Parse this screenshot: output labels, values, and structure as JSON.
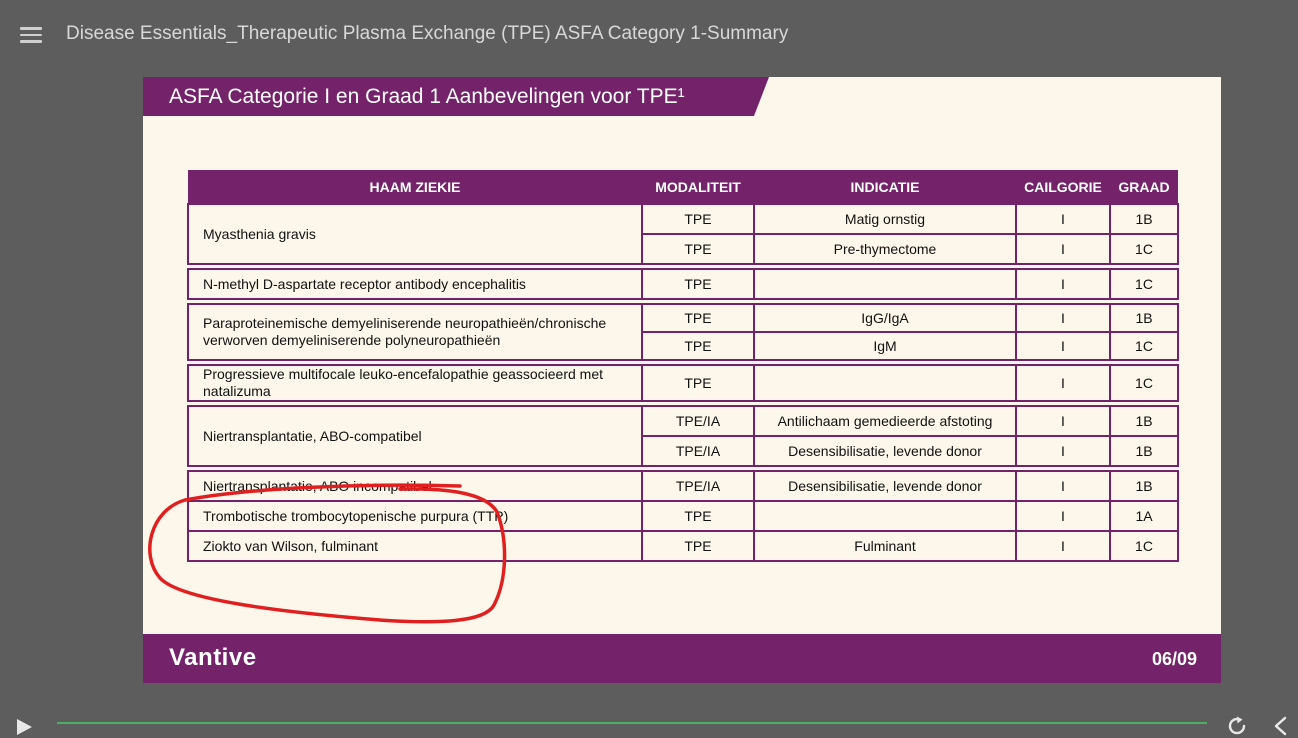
{
  "app": {
    "course_title": "Disease Essentials_Therapeutic Plasma Exchange (TPE) ASFA Category 1-Summary",
    "icons": {
      "menu": "hamburger-menu-icon",
      "play": "play-icon",
      "replay": "replay-icon",
      "back": "chevron-left-icon"
    },
    "colors": {
      "background": "#5d5d5d",
      "progress": "#4caf62"
    }
  },
  "slide": {
    "title": "ASFA Categorie I en Graad 1 Aanbevelingen voor TPE¹",
    "colors": {
      "brand": "#74226a",
      "paper": "#fcf7ea",
      "annotation": "#e02020"
    },
    "table": {
      "headers": [
        "HAAM ZIEKIE",
        "MODALITEIT",
        "INDICATIE",
        "CAILGORIE",
        "GRAAD"
      ],
      "groups": [
        {
          "name": "Myasthenia gravis",
          "rows": [
            {
              "modaliteit": "TPE",
              "indicatie": "Matig ornstig",
              "categorie": "I",
              "graad": "1B"
            },
            {
              "modaliteit": "TPE",
              "indicatie": "Pre-thymectome",
              "categorie": "I",
              "graad": "1C"
            }
          ]
        },
        {
          "name": "N-methyl D-aspartate receptor antibody encephalitis",
          "rows": [
            {
              "modaliteit": "TPE",
              "indicatie": "",
              "categorie": "I",
              "graad": "1C"
            }
          ]
        },
        {
          "name": "Paraproteinemische demyeliniserende neuropathieën/chronische verworven demyeliniserende polyneuropathieën",
          "rows": [
            {
              "modaliteit": "TPE",
              "indicatie": "IgG/IgA",
              "categorie": "I",
              "graad": "1B"
            },
            {
              "modaliteit": "TPE",
              "indicatie": "IgM",
              "categorie": "I",
              "graad": "1C"
            }
          ]
        },
        {
          "name": "Progressieve multifocale leuko-encefalopathie geassocieerd met natalizuma",
          "rows": [
            {
              "modaliteit": "TPE",
              "indicatie": "",
              "categorie": "I",
              "graad": "1C"
            }
          ]
        },
        {
          "name": "Niertransplantatie, ABO-compatibel",
          "rows": [
            {
              "modaliteit": "TPE/IA",
              "indicatie": "Antilichaam gemedieerde afstoting",
              "categorie": "I",
              "graad": "1B"
            },
            {
              "modaliteit": "TPE/IA",
              "indicatie": "Desensibilisatie, levende donor",
              "categorie": "I",
              "graad": "1B"
            }
          ]
        },
        {
          "name": "Niertransplantatie, ABO incompatibel",
          "rows": [
            {
              "modaliteit": "TPE/IA",
              "indicatie": "Desensibilisatie, levende donor",
              "categorie": "I",
              "graad": "1B"
            }
          ]
        },
        {
          "name": "Trombotische trombocytopenische purpura (TTP)",
          "rows": [
            {
              "modaliteit": "TPE",
              "indicatie": "",
              "categorie": "I",
              "graad": "1A"
            }
          ]
        },
        {
          "name": "Ziokto van Wilson, fulminant",
          "rows": [
            {
              "modaliteit": "TPE",
              "indicatie": "Fulminant",
              "categorie": "I",
              "graad": "1C"
            }
          ]
        }
      ]
    },
    "footer": {
      "logo": "Vantive",
      "page": "06/09"
    }
  }
}
